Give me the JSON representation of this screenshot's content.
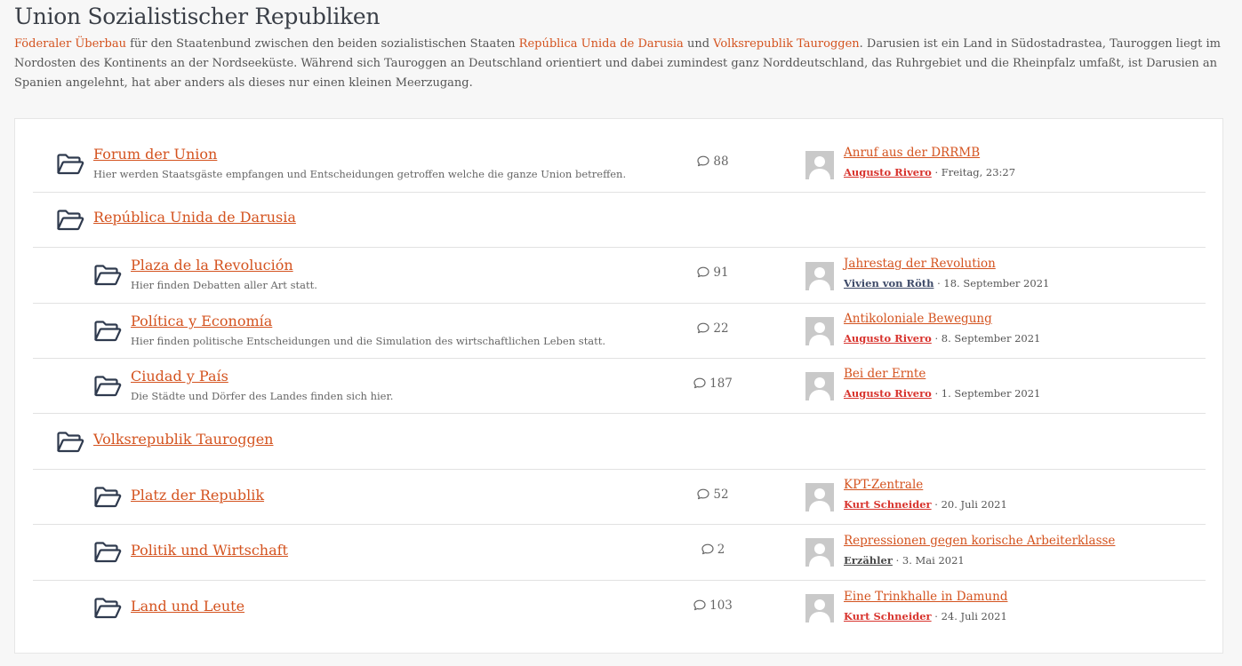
{
  "page": {
    "title": "Union Sozialistischer Republiken",
    "intro": {
      "link1": "Föderaler Überbau",
      "t1": " für den Staatenbund zwischen den beiden sozialistischen Staaten ",
      "link2": "República Unida de Darusia",
      "t2": " und ",
      "link3": "Volksrepublik Tauroggen",
      "t3": ". Darusien ist ein Land in Südostadrastea, Tauroggen liegt im Nordosten des Kontinents an der Nordseeküste. Während sich Tauroggen an Deutschland orientiert und dabei zumindest ganz Norddeutschland, das Ruhrgebiet und die Rheinpfalz umfaßt, ist Darusien an Spanien angelehnt, hat aber anders als dieses nur einen kleinen Meerzugang."
    }
  },
  "icons": {
    "folder": "folder-open-icon",
    "comments": "speech-bubble-icon",
    "avatar": "default-avatar"
  },
  "colors": {
    "link": "#d4531f",
    "author_red": "#d8342e",
    "author_blue": "#3e4a68"
  },
  "boards": [
    {
      "title": "Forum der Union",
      "desc": "Hier werden Staatsgäste empfangen und Entscheidungen getroffen welche die ganze Union betreffen.",
      "count": "88",
      "last_title": "Anruf aus der DRRMB",
      "last_author": "Augusto Rivero",
      "last_date": " · Freitag, 23:27"
    },
    {
      "title": "República Unida de Darusia"
    },
    {
      "title": "Plaza de la Revolución",
      "desc": "Hier finden Debatten aller Art statt.",
      "count": "91",
      "last_title": "Jahrestag der Revolution",
      "last_author": "Vivien von Röth",
      "last_date": " · 18. September 2021"
    },
    {
      "title": "Política y Economía",
      "desc": "Hier finden politische Entscheidungen und die Simulation des wirtschaftlichen Leben statt.",
      "count": "22",
      "last_title": "Antikoloniale Bewegung",
      "last_author": "Augusto Rivero",
      "last_date": " · 8. September 2021"
    },
    {
      "title": "Ciudad y País",
      "desc": "Die Städte und Dörfer des Landes finden sich hier.",
      "count": "187",
      "last_title": "Bei der Ernte",
      "last_author": "Augusto Rivero",
      "last_date": " · 1. September 2021"
    },
    {
      "title": "Volksrepublik Tauroggen"
    },
    {
      "title": "Platz der Republik",
      "count": "52",
      "last_title": "KPT-Zentrale",
      "last_author": "Kurt Schneider",
      "last_date": " · 20. Juli 2021"
    },
    {
      "title": "Politik und Wirtschaft",
      "count": "2",
      "last_title": "Repressionen gegen korische Arbeiterklasse",
      "last_author": "Erzähler",
      "last_date": " · 3. Mai 2021"
    },
    {
      "title": "Land und Leute",
      "count": "103",
      "last_title": "Eine Trinkhalle in Damund",
      "last_author": "Kurt Schneider",
      "last_date": " · 24. Juli 2021"
    }
  ]
}
